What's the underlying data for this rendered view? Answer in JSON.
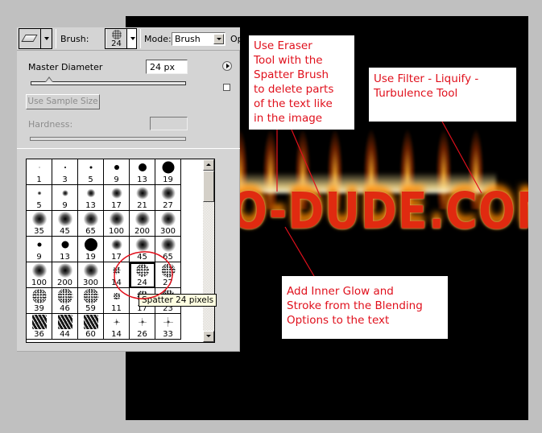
{
  "options_bar": {
    "tool_icon": "eraser-icon",
    "brush_label": "Brush:",
    "brush_size": "24",
    "mode_label": "Mode:",
    "mode_value": "Brush",
    "opacity_label": "Opacity"
  },
  "brush_panel": {
    "master_diameter_label": "Master Diameter",
    "master_diameter_value": "24 px",
    "master_diameter_slider_fraction": 0.12,
    "use_sample_size_label": "Use Sample Size",
    "hardness_label": "Hardness:",
    "hardness_value": "",
    "presets": [
      {
        "size": "1",
        "type": "hard",
        "d": 1
      },
      {
        "size": "3",
        "type": "hard",
        "d": 2
      },
      {
        "size": "5",
        "type": "hard",
        "d": 3
      },
      {
        "size": "9",
        "type": "hard",
        "d": 6
      },
      {
        "size": "13",
        "type": "hard",
        "d": 10
      },
      {
        "size": "19",
        "type": "hard",
        "d": 15
      },
      {
        "size": "5",
        "type": "soft",
        "d": 5
      },
      {
        "size": "9",
        "type": "soft",
        "d": 8
      },
      {
        "size": "13",
        "type": "soft",
        "d": 11
      },
      {
        "size": "17",
        "type": "soft",
        "d": 14
      },
      {
        "size": "21",
        "type": "soft",
        "d": 16
      },
      {
        "size": "27",
        "type": "soft",
        "d": 18
      },
      {
        "size": "35",
        "type": "soft",
        "d": 19
      },
      {
        "size": "45",
        "type": "soft",
        "d": 19
      },
      {
        "size": "65",
        "type": "soft",
        "d": 19
      },
      {
        "size": "100",
        "type": "soft",
        "d": 19
      },
      {
        "size": "200",
        "type": "soft",
        "d": 19
      },
      {
        "size": "300",
        "type": "soft",
        "d": 19
      },
      {
        "size": "9",
        "type": "hard",
        "d": 5
      },
      {
        "size": "13",
        "type": "hard",
        "d": 9
      },
      {
        "size": "19",
        "type": "hard",
        "d": 16
      },
      {
        "size": "17",
        "type": "soft",
        "d": 14
      },
      {
        "size": "45",
        "type": "soft",
        "d": 18
      },
      {
        "size": "65",
        "type": "soft",
        "d": 19
      },
      {
        "size": "100",
        "type": "soft",
        "d": 19
      },
      {
        "size": "200",
        "type": "soft",
        "d": 19
      },
      {
        "size": "300",
        "type": "soft",
        "d": 19
      },
      {
        "size": "14",
        "type": "spat",
        "d": 10
      },
      {
        "size": "24",
        "type": "spat",
        "d": 16,
        "selected": true
      },
      {
        "size": "27",
        "type": "spat",
        "d": 17
      },
      {
        "size": "39",
        "type": "spat",
        "d": 18
      },
      {
        "size": "46",
        "type": "spat",
        "d": 19
      },
      {
        "size": "59",
        "type": "spat",
        "d": 19
      },
      {
        "size": "11",
        "type": "spat",
        "d": 9
      },
      {
        "size": "17",
        "type": "spat",
        "d": 14
      },
      {
        "size": "23",
        "type": "spat",
        "d": 16
      },
      {
        "size": "36",
        "type": "chalk",
        "d": 18
      },
      {
        "size": "44",
        "type": "chalk",
        "d": 18
      },
      {
        "size": "60",
        "type": "chalk",
        "d": 18
      },
      {
        "size": "14",
        "type": "star",
        "d": 8
      },
      {
        "size": "26",
        "type": "star",
        "d": 10
      },
      {
        "size": "33",
        "type": "star",
        "d": 12
      }
    ],
    "tooltip": "Spatter 24 pixels"
  },
  "canvas": {
    "text": "O-DUDE.COM",
    "background": "#000000"
  },
  "annotations": [
    {
      "id": "eraser",
      "text": "Use Eraser\nTool with the\nSpatter Brush\nto delete parts\nof the text like\nin the image"
    },
    {
      "id": "liquify",
      "text": "Use Filter - Liquify -\nTurbulence Tool"
    },
    {
      "id": "glow",
      "text": "Add Inner Glow and\nStroke from the Blending\nOptions to the text"
    }
  ],
  "colors": {
    "annotation_text": "#e0101c",
    "annotation_line": "#e0101c",
    "panel_bg": "#d4d4d4",
    "workspace_bg": "#c0c0c0"
  }
}
